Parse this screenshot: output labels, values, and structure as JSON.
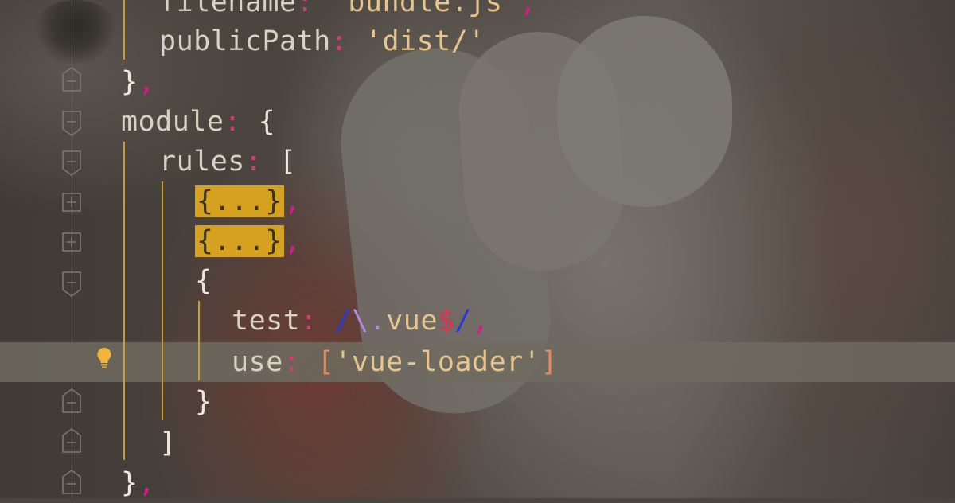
{
  "editor": {
    "line_filename": {
      "key": "filename",
      "colon": ":",
      "value": "'bundle.js'",
      "comma": ","
    },
    "line_publicPath": {
      "key": "publicPath",
      "colon": ":",
      "value": "'dist/'"
    },
    "line_output_close": {
      "brace": "}",
      "comma": ","
    },
    "line_module": {
      "key": "module",
      "colon": ":",
      "brace": "{"
    },
    "line_rules": {
      "key": "rules",
      "colon": ":",
      "bracket": "["
    },
    "line_fold1": {
      "text": "{...}",
      "comma": ","
    },
    "line_fold2": {
      "text": "{...}",
      "comma": ","
    },
    "line_obj_open": {
      "brace": "{"
    },
    "line_test": {
      "key": "test",
      "colon": ":",
      "slash1": "/",
      "esc": "\\",
      "dot": ".",
      "word": "vue",
      "dollar": "$",
      "slash2": "/",
      "comma": ","
    },
    "line_use": {
      "key": "use",
      "colon": ":",
      "open": "[",
      "value": "'vue-loader'",
      "close": "]"
    },
    "line_obj_close": {
      "brace": "}"
    },
    "line_rules_close": {
      "bracket": "]"
    },
    "line_module_close": {
      "brace": "}",
      "comma": ","
    }
  },
  "icons": {
    "intention": "lightbulb-icon",
    "fold_open": "fold-collapse-icon",
    "fold_closed": "fold-expand-icon"
  },
  "colors": {
    "fold_highlight": "#d5a21f",
    "guide": "#c79f2e",
    "colon": "#d23a7c",
    "string": "#e7c48a"
  }
}
